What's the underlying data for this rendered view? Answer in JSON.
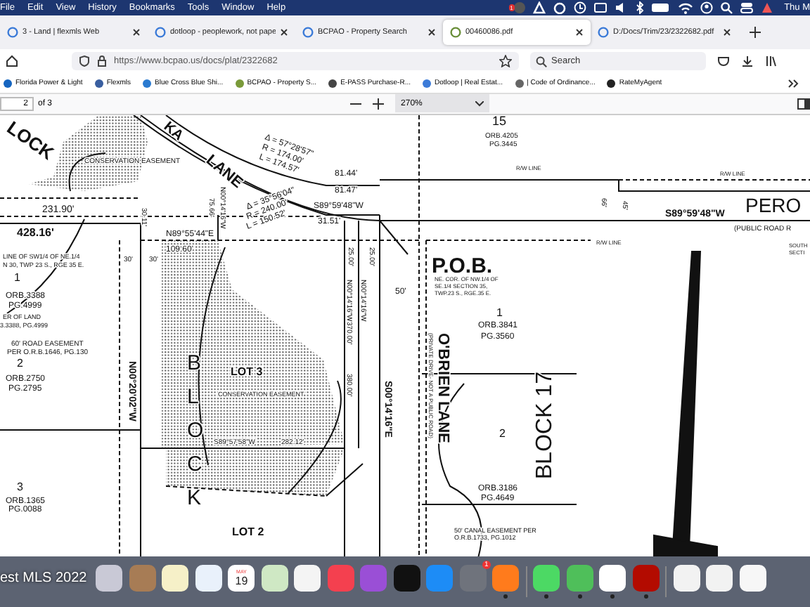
{
  "menu_bar": {
    "items": [
      "File",
      "Edit",
      "View",
      "History",
      "Bookmarks",
      "Tools",
      "Window",
      "Help"
    ],
    "badge": "1",
    "clock": "Thu M"
  },
  "tabs": [
    {
      "title": "3 - Land | flexmls Web",
      "selected": false
    },
    {
      "title": "dotloop - peoplework, not pape",
      "selected": false
    },
    {
      "title": "BCPAO - Property Search",
      "selected": false
    },
    {
      "title": "00460086.pdf",
      "selected": true
    },
    {
      "title": "D:/Docs/Trim/23/2322682.pdf",
      "selected": false
    }
  ],
  "toolbar": {
    "url": "https://www.bcpao.us/docs/plat/2322682",
    "search": {
      "placeholder": "Search"
    }
  },
  "bookmarks": [
    "Florida Power & Light",
    "Flexmls",
    "Blue Cross Blue Shi...",
    "BCPAO - Property S...",
    "E-PASS Purchase-R...",
    "Dotloop | Real Estat...",
    "| Code of Ordinance...",
    "RateMyAgent"
  ],
  "pdf_toolbar": {
    "page": "2",
    "page_count": "of 3",
    "zoom": "270%"
  },
  "plat": {
    "labels": [
      "LOCK",
      "KA",
      "LANE",
      "CONSERVATION EASEMENT",
      "Δ = 57°28'57\"",
      "R = 174.00'",
      "L = 174.57'",
      "81.44'",
      "81.47'",
      "S89°59'48\"W",
      "31.51'",
      "Δ = 35°56'04\"",
      "R = 240.00'",
      "L = 150.52'",
      "231.90'",
      "428.16'",
      "N89°55'44\"E",
      "109.60'",
      "LINE OF SW1/4 OF NE.1/4",
      "N 30, TWP 23 S., RGE 35 E.",
      "1",
      "ORB.3388",
      "PG.4999",
      "ER OF LAND",
      "3.3388, PG.4999",
      "60' ROAD EASEMENT",
      "PER O.R.B.1646, PG.130",
      "30'",
      "30'",
      "50'",
      "15",
      "ORB.4205",
      "PG.3445",
      "R/W LINE",
      "R/W LINE",
      "PERO",
      "(PUBLIC ROAD R",
      "S89°59'48\"W",
      "R/W LINE",
      "P.O.B.",
      "NE. COR. OF NW.1/4 OF",
      "SE.1/4 SECTION 35,",
      "TWP.23 S., RGE.35 E.",
      "1",
      "ORB.3841",
      "PG.3560",
      "SOUTH",
      "SECTI",
      "O'BRIEN LANE",
      "(PRIVATE DRIVE- NOT A PUBLIC ROAD)",
      "BLOCK 17",
      "2",
      "ORB.3186",
      "PG.4649",
      "50' CANAL EASEMENT PER",
      "O.R.B.1733, PG.1012",
      "2",
      "ORB.2750",
      "PG.2795",
      "3",
      "ORB.1365",
      "PG.0088",
      "N00°20'02\"W",
      "LOT 3",
      "CONSERVATION EASEMENT",
      "S89°57'58\"W",
      "282.12'",
      "LOT 2",
      "380.00'",
      "S00°14'16\"E",
      "370.00'",
      "25.00'",
      "25.00'",
      "N00°14'16\"W",
      "N00°14'16\"W",
      "75.66'",
      "N00°14'16\"W",
      "30.11'",
      "66'",
      "45'"
    ],
    "block_letters": "BLOCK"
  },
  "dock": {
    "overlay_label": "est MLS 2022",
    "calendar_month": "MAY",
    "calendar_day": "19",
    "settings_badge": "1",
    "apps": [
      {
        "kind": "launchpad",
        "running": false
      },
      {
        "kind": "contacts",
        "running": false
      },
      {
        "kind": "notes",
        "running": false
      },
      {
        "kind": "safari",
        "running": false
      },
      {
        "kind": "calendar",
        "running": false
      },
      {
        "kind": "maps",
        "running": false
      },
      {
        "kind": "photos",
        "running": false
      },
      {
        "kind": "music",
        "running": false
      },
      {
        "kind": "podcasts",
        "running": false
      },
      {
        "kind": "tv",
        "running": false
      },
      {
        "kind": "appstore",
        "running": false
      },
      {
        "kind": "settings",
        "running": false
      },
      {
        "kind": "firefox",
        "running": true
      },
      {
        "kind": "divider"
      },
      {
        "kind": "messages",
        "running": true
      },
      {
        "kind": "findmy",
        "running": true
      },
      {
        "kind": "excel",
        "running": true
      },
      {
        "kind": "acrobat",
        "running": true
      },
      {
        "kind": "divider"
      },
      {
        "kind": "window",
        "running": false
      },
      {
        "kind": "window",
        "running": false
      },
      {
        "kind": "document",
        "running": false
      }
    ]
  }
}
